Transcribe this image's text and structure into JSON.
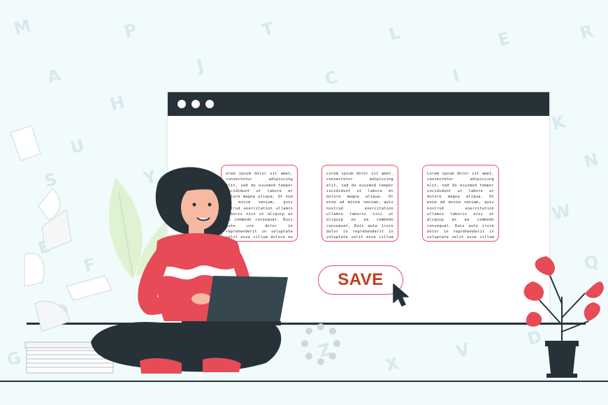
{
  "browser": {
    "window_dots": [
      "dot",
      "dot",
      "dot"
    ]
  },
  "cards": [
    {
      "text": "orem ipsum dolor sit amet, consectetur adipiscing elit, sed do eiusmod tempor incididunt ut labore et dolore magna aliqua. Ut nim ad minim veniam, quis ostrud exercitation ullamco laboris nisi ut aliquip ex ea commodo consequat. Duis aute ure dolor in reprehenderit in voluptate velit esse cillum dolore eu fugiat nulla pariatur. Excepteur sint occaecat cupidatat non proident, sunt in culpa qui officia deserunt"
    },
    {
      "text": "Lorem ipsum dolor sit amet, consectetur adipiscing elit, sed do eiusmod tempor incididunt ut labore et dolore magna aliqua. Ut enim ad minim veniam, quis nostrud exercitation ullamco laboris nisi ut aliquip ex ea commodo consequat. Duis aute irure dolor in reprehenderit in voluptate velit esse cillum dolore eu fugiat nulla pariatur. Excepteur sint occaecat cupidatat non proident, sunt in culpa qui officia deserunt"
    },
    {
      "text": "Lorem ipsum dolor sit amet, consectetur adipiscing elit, sed do eiusmod tempor incididunt ut labore et dolore magna aliqua. Ut enim ad minim veniam, quis nostrud exercitation ullamco laboris nisi ut aliquip ex ea commodo consequat. Duis aute irure dolor in reprehenderit in voluptate velit esse cillum dolore eu fugiat nulla pariatur. Excepteur sint occaecat cupidatat non proident, sunt in culpa qui officia deserunt"
    }
  ],
  "save_button": {
    "label": "SAVE"
  },
  "background_letters": [
    "M",
    "P",
    "T",
    "L",
    "E",
    "R",
    "A",
    "J",
    "C",
    "I",
    "H",
    "U",
    "S",
    "Y",
    "B",
    "F",
    "O",
    "G",
    "K",
    "N",
    "W",
    "Q",
    "D",
    "V",
    "Z",
    "X"
  ],
  "colors": {
    "background": "#f1fbfb",
    "dark": "#263238",
    "accent_red": "#e0505f",
    "save_text": "#c53b1e",
    "sweater": "#e64b57",
    "leaf_light": "#dff3d4"
  },
  "icons": [
    "cursor-arrow-icon",
    "plant-icon",
    "paper-stack-icon",
    "loading-spinner-icon"
  ]
}
